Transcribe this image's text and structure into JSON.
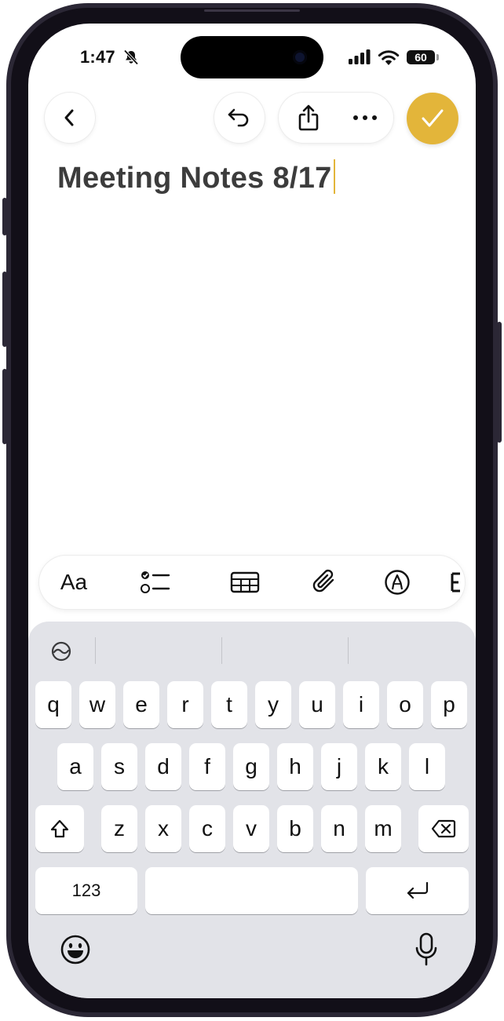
{
  "status_bar": {
    "time": "1:47",
    "battery": "60",
    "icons": [
      "bell-slash-icon",
      "cellular-signal-icon",
      "wifi-icon",
      "battery-icon"
    ]
  },
  "nav": {
    "icons": [
      "chevron-left-icon",
      "undo-icon",
      "share-icon",
      "more-icon",
      "checkmark-icon"
    ],
    "accent_color": "#e3b53a"
  },
  "note": {
    "title": "Meeting Notes 8/17"
  },
  "format_toolbar": {
    "text_style_label": "Aa",
    "icons": [
      "text-format-icon",
      "checklist-icon",
      "table-icon",
      "paperclip-icon",
      "markup-pen-icon",
      "more-tools-icon"
    ]
  },
  "keyboard": {
    "row1": [
      "q",
      "w",
      "e",
      "r",
      "t",
      "y",
      "u",
      "i",
      "o",
      "p"
    ],
    "row2": [
      "a",
      "s",
      "d",
      "f",
      "g",
      "h",
      "j",
      "k",
      "l"
    ],
    "row3": [
      "z",
      "x",
      "c",
      "v",
      "b",
      "n",
      "m"
    ],
    "numbers_label": "123",
    "icons": [
      "writing-tools-icon",
      "shift-icon",
      "delete-icon",
      "return-icon",
      "emoji-icon",
      "microphone-icon"
    ]
  }
}
